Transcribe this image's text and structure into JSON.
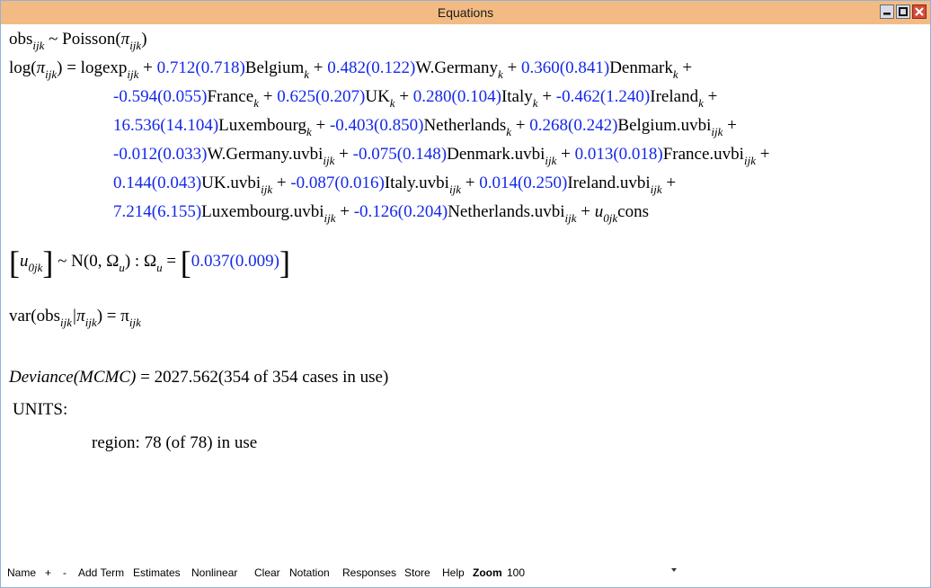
{
  "window": {
    "title": "Equations"
  },
  "equations": {
    "l1": {
      "obs": "obs",
      "sub_ijk": "ijk",
      "pois": " ~ Poisson(",
      "pi": "π",
      "close": ")"
    },
    "l2": {
      "log": "log(",
      "pi": "π",
      "sub_ijk": "ijk",
      "eq": ") = logexp",
      "logexp_sub": "ijk",
      "plus": " + "
    },
    "terms": [
      {
        "coef": "0.712(0.718)",
        "name": "Belgium",
        "sub": "k"
      },
      {
        "coef": "0.482(0.122)",
        "name": "W.Germany",
        "sub": "k"
      },
      {
        "coef": "0.360(0.841)",
        "name": "Denmark",
        "sub": "k"
      },
      {
        "coef": "-0.594(0.055)",
        "name": "France",
        "sub": "k"
      },
      {
        "coef": "0.625(0.207)",
        "name": "UK",
        "sub": "k"
      },
      {
        "coef": "0.280(0.104)",
        "name": "Italy",
        "sub": "k"
      },
      {
        "coef": "-0.462(1.240)",
        "name": "Ireland",
        "sub": "k"
      },
      {
        "coef": "16.536(14.104)",
        "name": "Luxembourg",
        "sub": "k"
      },
      {
        "coef": "-0.403(0.850)",
        "name": "Netherlands",
        "sub": "k"
      },
      {
        "coef": "0.268(0.242)",
        "name": "Belgium.uvbi",
        "sub": "ijk"
      },
      {
        "coef": "-0.012(0.033)",
        "name": "W.Germany.uvbi",
        "sub": "ijk"
      },
      {
        "coef": "-0.075(0.148)",
        "name": "Denmark.uvbi",
        "sub": "ijk"
      },
      {
        "coef": "0.013(0.018)",
        "name": "France.uvbi",
        "sub": "ijk"
      },
      {
        "coef": "0.144(0.043)",
        "name": "UK.uvbi",
        "sub": "ijk"
      },
      {
        "coef": "-0.087(0.016)",
        "name": "Italy.uvbi",
        "sub": "ijk"
      },
      {
        "coef": "0.014(0.250)",
        "name": "Ireland.uvbi",
        "sub": "ijk"
      },
      {
        "coef": "7.214(6.155)",
        "name": "Luxembourg.uvbi",
        "sub": "ijk"
      },
      {
        "coef": "-0.126(0.204)",
        "name": "Netherlands.uvbi",
        "sub": "ijk"
      }
    ],
    "u_term": {
      "u": "u",
      "sub": "0jk",
      "cons": "cons"
    },
    "random": {
      "u": "u",
      "u_sub": "0jk",
      "dist": " ~ N(0,  Ω",
      "dist_sub": "u",
      "mid": ")  :  Ω",
      "omega_sub": "u",
      "eq": " = ",
      "value": "0.037(0.009)"
    },
    "var": {
      "a": "var(obs",
      "a_sub": "ijk",
      "b": "|π",
      "b_sub": "ijk",
      "c": ") = π",
      "c_sub": "ijk"
    },
    "deviance": {
      "label": "Deviance(MCMC)",
      "rest": " = 2027.562(354 of 354 cases in use)"
    },
    "units_label": "UNITS:",
    "region": "region: 78 (of 78) in use"
  },
  "toolbar": {
    "items": [
      "Name",
      "+",
      "-",
      "Add Term",
      "Estimates",
      "Nonlinear",
      "Clear",
      "Notation",
      "Responses",
      "Store",
      "Help"
    ],
    "zoom_label": "Zoom",
    "zoom_value": "100"
  },
  "colors": {
    "titlebar": "#f3bb83",
    "estimate": "#1428e8",
    "close_button": "#d64a3a"
  }
}
